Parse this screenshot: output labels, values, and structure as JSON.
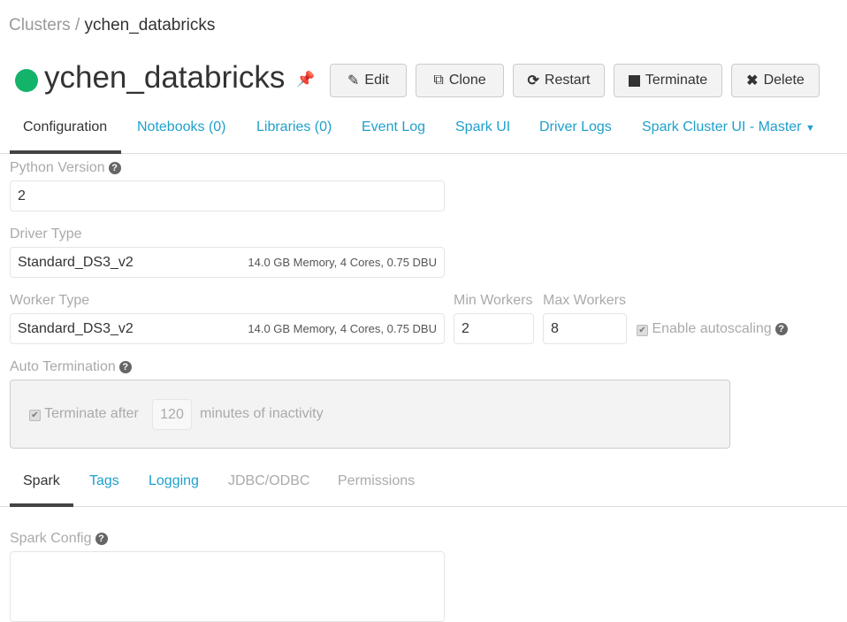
{
  "breadcrumb": {
    "root": "Clusters",
    "separator": "/",
    "current": "ychen_databricks"
  },
  "cluster": {
    "name": "ychen_databricks",
    "status_color": "#13b36a"
  },
  "actions": {
    "edit": "Edit",
    "clone": "Clone",
    "restart": "Restart",
    "terminate": "Terminate",
    "delete": "Delete"
  },
  "tabs": [
    "Configuration",
    "Notebooks (0)",
    "Libraries (0)",
    "Event Log",
    "Spark UI",
    "Driver Logs",
    "Spark Cluster UI - Master"
  ],
  "config": {
    "python_version_label": "Python Version",
    "python_version": "2",
    "driver_type_label": "Driver Type",
    "driver_type": "Standard_DS3_v2",
    "driver_specs": "14.0 GB Memory, 4 Cores, 0.75 DBU",
    "worker_type_label": "Worker Type",
    "worker_type": "Standard_DS3_v2",
    "worker_specs": "14.0 GB Memory, 4 Cores, 0.75 DBU",
    "min_workers_label": "Min Workers",
    "min_workers": "2",
    "max_workers_label": "Max Workers",
    "max_workers": "8",
    "autoscaling_label": "Enable autoscaling",
    "auto_termination_label": "Auto Termination",
    "terminate_after": "Terminate after",
    "terminate_minutes": "120",
    "inactivity": "minutes of inactivity"
  },
  "subtabs": [
    "Spark",
    "Tags",
    "Logging",
    "JDBC/ODBC",
    "Permissions"
  ],
  "spark_config_label": "Spark Config"
}
